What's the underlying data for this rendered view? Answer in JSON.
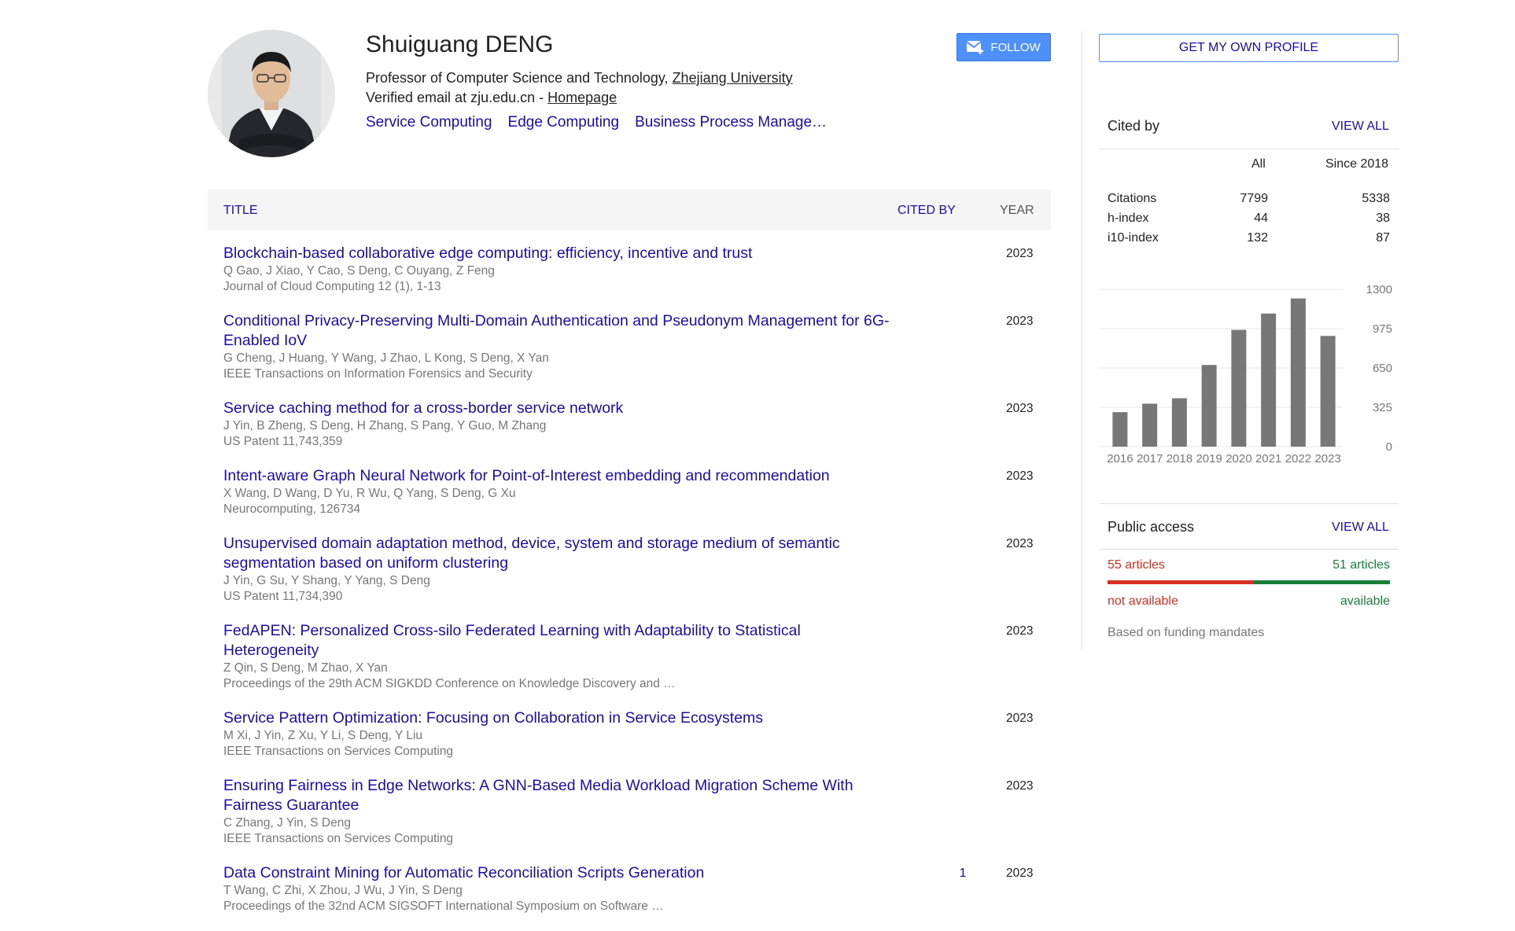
{
  "profile": {
    "name": "Shuiguang DENG",
    "affiliation_prefix": "Professor of Computer Science and Technology, ",
    "affiliation_link": "Zhejiang University",
    "email_prefix": "Verified email at zju.edu.cn - ",
    "homepage": "Homepage",
    "interests": [
      "Service Computing",
      "Edge Computing",
      "Business Process Manage…"
    ],
    "follow_label": "FOLLOW"
  },
  "table": {
    "col_title": "TITLE",
    "col_cited": "CITED BY",
    "col_year": "YEAR",
    "rows": [
      {
        "title": "Blockchain-based collaborative edge computing: efficiency, incentive and trust",
        "authors": "Q Gao, J Xiao, Y Cao, S Deng, C Ouyang, Z Feng",
        "venue": "Journal of Cloud Computing 12 (1), 1-13",
        "cited": "",
        "year": "2023"
      },
      {
        "title": "Conditional Privacy-Preserving Multi-Domain Authentication and Pseudonym Management for 6G-Enabled IoV",
        "authors": "G Cheng, J Huang, Y Wang, J Zhao, L Kong, S Deng, X Yan",
        "venue": "IEEE Transactions on Information Forensics and Security",
        "cited": "",
        "year": "2023"
      },
      {
        "title": "Service caching method for a cross-border service network",
        "authors": "J Yin, B Zheng, S Deng, H Zhang, S Pang, Y Guo, M Zhang",
        "venue": "US Patent 11,743,359",
        "cited": "",
        "year": "2023"
      },
      {
        "title": "Intent-aware Graph Neural Network for Point-of-Interest embedding and recommendation",
        "authors": "X Wang, D Wang, D Yu, R Wu, Q Yang, S Deng, G Xu",
        "venue": "Neurocomputing, 126734",
        "cited": "",
        "year": "2023"
      },
      {
        "title": "Unsupervised domain adaptation method, device, system and storage medium of semantic segmentation based on uniform clustering",
        "authors": "J Yin, G Su, Y Shang, Y Yang, S Deng",
        "venue": "US Patent 11,734,390",
        "cited": "",
        "year": "2023"
      },
      {
        "title": "FedAPEN: Personalized Cross-silo Federated Learning with Adaptability to Statistical Heterogeneity",
        "authors": "Z Qin, S Deng, M Zhao, X Yan",
        "venue": "Proceedings of the 29th ACM SIGKDD Conference on Knowledge Discovery and …",
        "cited": "",
        "year": "2023"
      },
      {
        "title": "Service Pattern Optimization: Focusing on Collaboration in Service Ecosystems",
        "authors": "M Xi, J Yin, Z Xu, Y Li, S Deng, Y Liu",
        "venue": "IEEE Transactions on Services Computing",
        "cited": "",
        "year": "2023"
      },
      {
        "title": "Ensuring Fairness in Edge Networks: A GNN-Based Media Workload Migration Scheme With Fairness Guarantee",
        "authors": "C Zhang, J Yin, S Deng",
        "venue": "IEEE Transactions on Services Computing",
        "cited": "",
        "year": "2023"
      },
      {
        "title": "Data Constraint Mining for Automatic Reconciliation Scripts Generation",
        "authors": "T Wang, C Zhi, X Zhou, J Wu, J Yin, S Deng",
        "venue": "Proceedings of the 32nd ACM SIGSOFT International Symposium on Software …",
        "cited": "1",
        "year": "2023"
      }
    ]
  },
  "sidebar": {
    "get_profile_label": "GET MY OWN PROFILE",
    "cited_by": {
      "title": "Cited by",
      "view_all": "VIEW ALL",
      "col_all": "All",
      "col_since": "Since 2018",
      "stats": [
        {
          "label": "Citations",
          "all": "7799",
          "since": "5338"
        },
        {
          "label": "h-index",
          "all": "44",
          "since": "38"
        },
        {
          "label": "i10-index",
          "all": "132",
          "since": "87"
        }
      ]
    },
    "public_access": {
      "title": "Public access",
      "view_all": "VIEW ALL",
      "not_available_count": "55 articles",
      "available_count": "51 articles",
      "not_available_label": "not available",
      "available_label": "available",
      "note": "Based on funding mandates",
      "not_available_color": "#d93025",
      "available_color": "#188038",
      "not_available_fraction": 0.519
    }
  },
  "chart_data": {
    "type": "bar",
    "categories": [
      "2016",
      "2017",
      "2018",
      "2019",
      "2020",
      "2021",
      "2022",
      "2023"
    ],
    "values": [
      285,
      355,
      400,
      675,
      965,
      1100,
      1225,
      915
    ],
    "ylim": [
      0,
      1300
    ],
    "yticks": [
      "0",
      "325",
      "650",
      "975",
      "1300"
    ],
    "bar_color": "#777777"
  }
}
